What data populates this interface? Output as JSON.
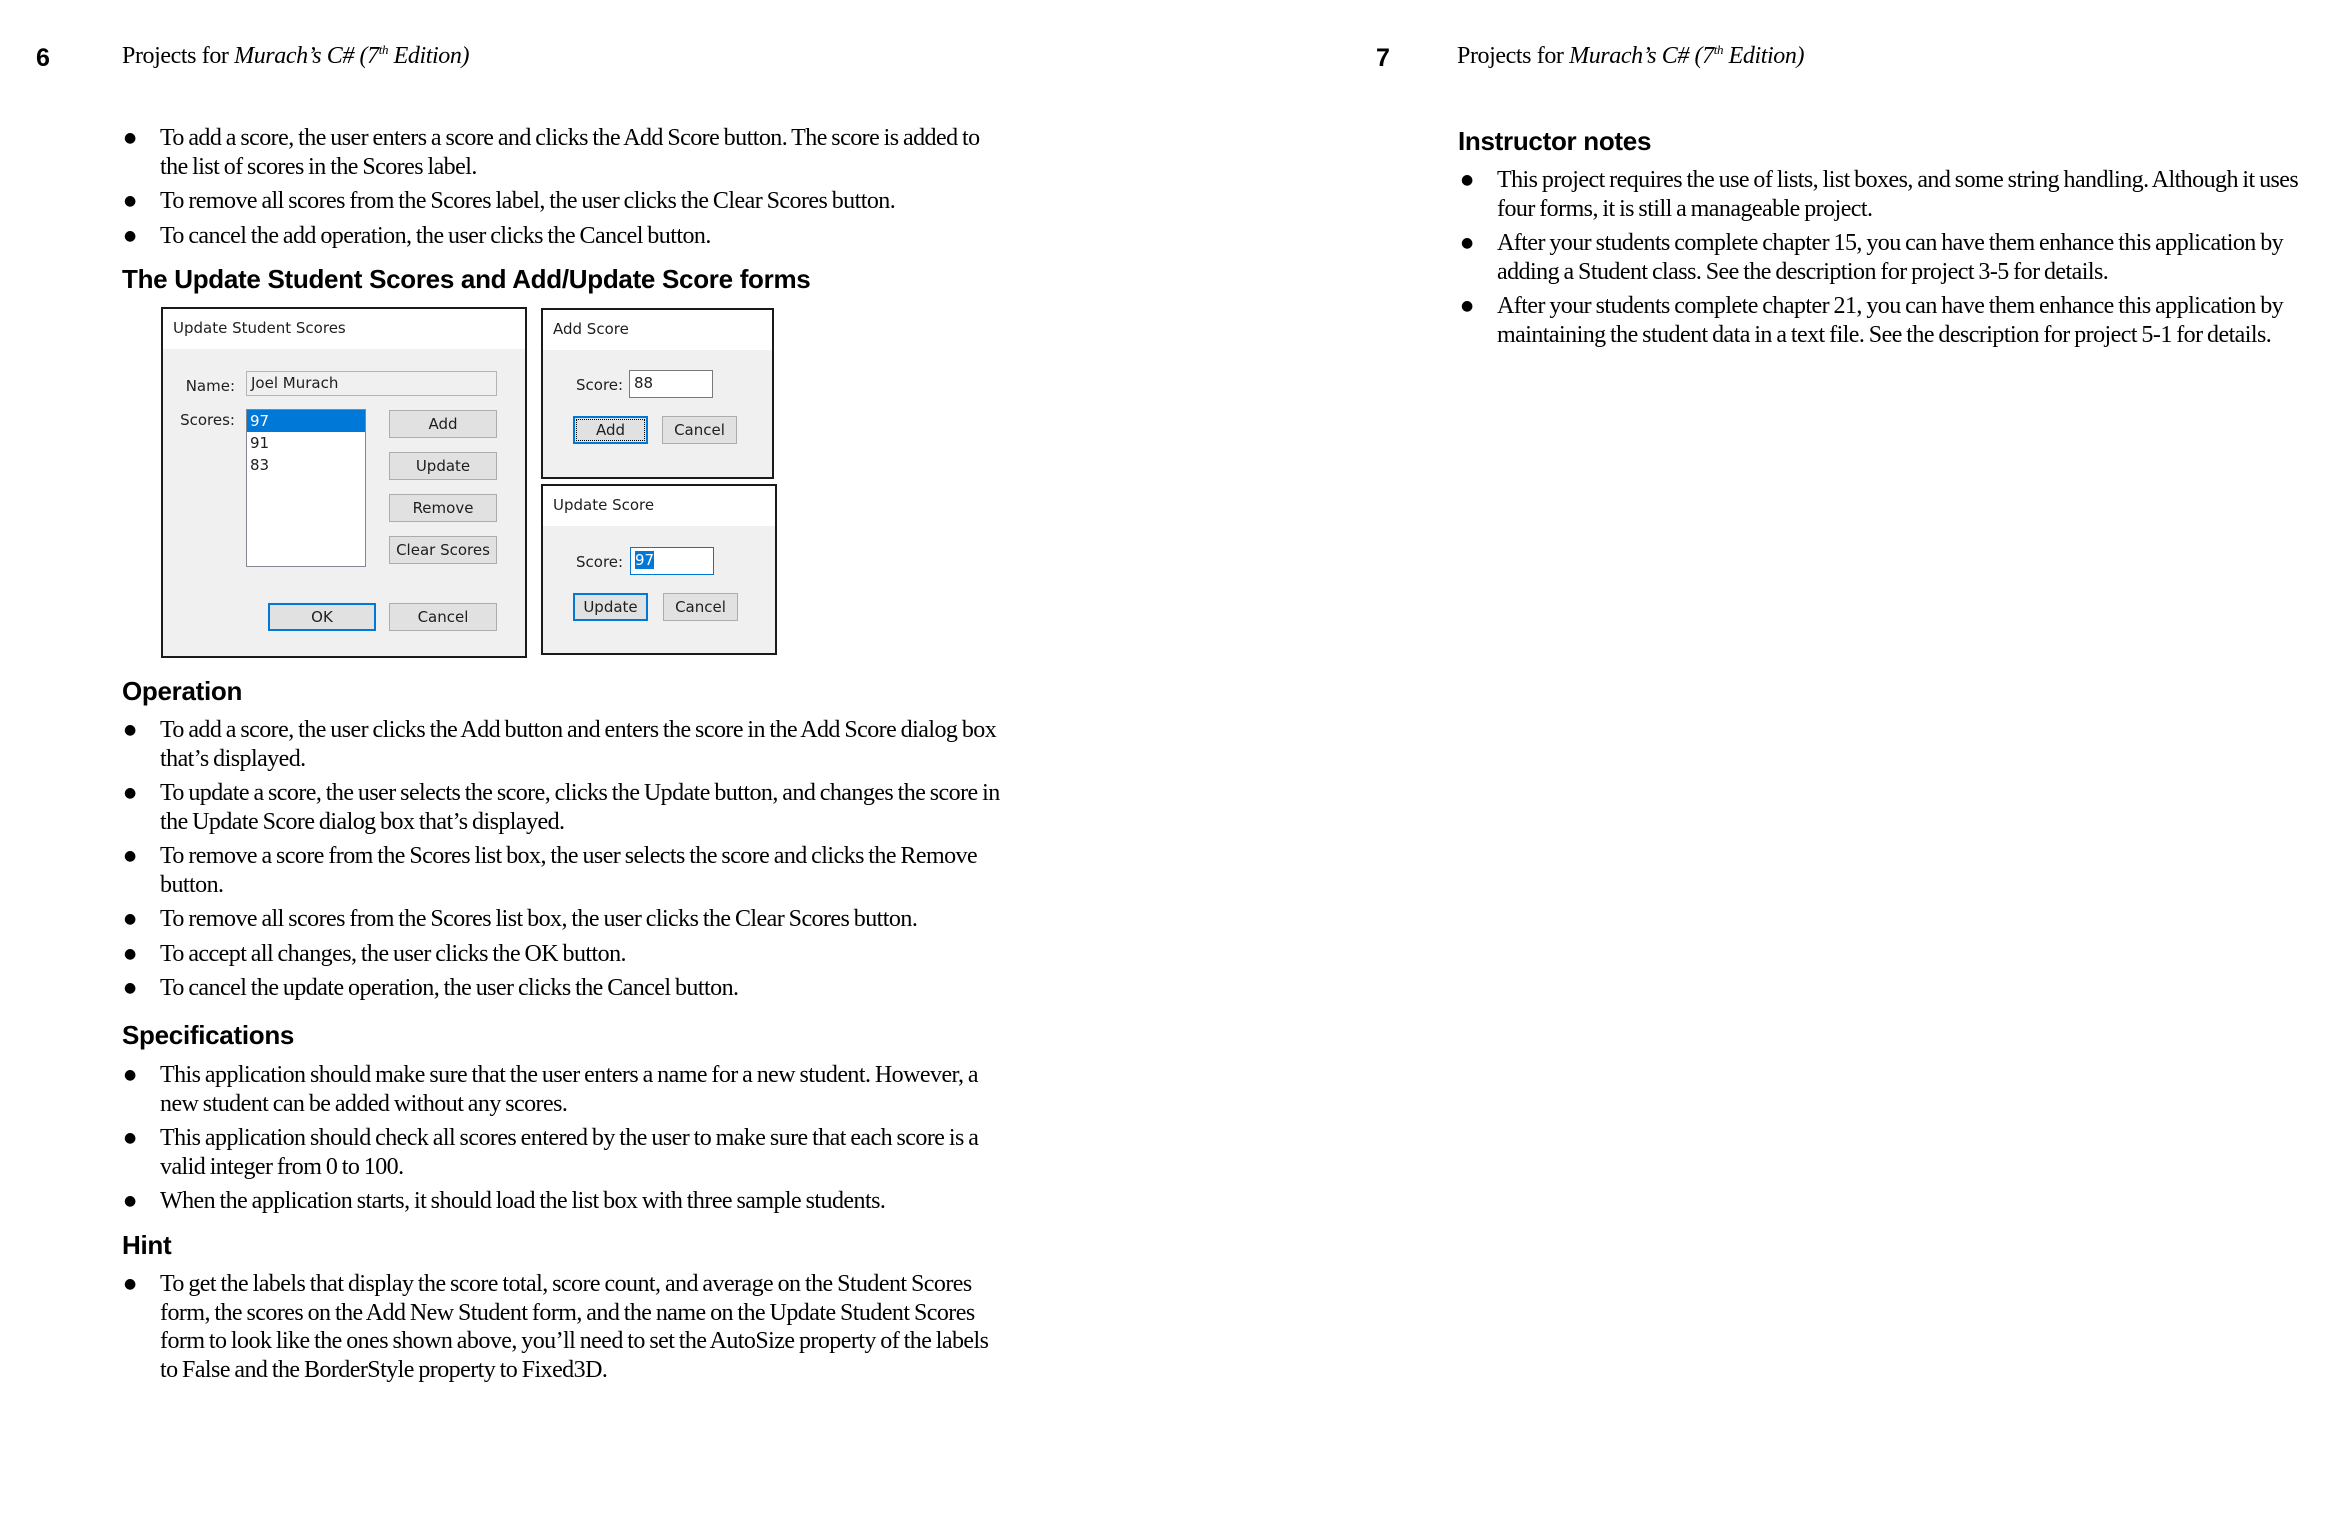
{
  "pages": {
    "left": {
      "page_number": "6",
      "running_head": {
        "prefix": "Projects for ",
        "book": "Murach’s C# (7",
        "sup": "th",
        "suffix": " Edition)"
      },
      "intro_bullets": [
        "To add a score, the user enters a score and clicks the Add Score button. The score is added to the list of scores in the Scores label.",
        "To remove all scores from the Scores label, the user clicks the Clear Scores button.",
        "To cancel the add operation, the user clicks the Cancel button."
      ],
      "forms_heading": "The Update Student Scores and Add/Update Score forms",
      "operation": {
        "heading": "Operation",
        "bullets": [
          "To add a score, the user clicks the Add button and enters the score in the Add Score dialog box that’s displayed.",
          "To update a score, the user selects the score, clicks the Update button, and changes the score in the Update Score dialog box that’s displayed.",
          "To remove a score from the Scores list box, the user selects the score and clicks the Remove button.",
          "To remove all scores from the Scores list box, the user clicks the Clear Scores button.",
          "To accept all changes, the user clicks the OK button.",
          "To cancel the update operation, the user clicks the Cancel button."
        ]
      },
      "specifications": {
        "heading": "Specifications",
        "bullets": [
          "This application should make sure that the user enters a name for a new student. However, a new student can be added without any scores.",
          "This application should check all scores entered by the user to make sure that each score is a valid integer from 0 to 100.",
          "When the application starts, it should load the list box with three sample students."
        ]
      },
      "hint": {
        "heading": "Hint",
        "bullets": [
          "To get the labels that display the score total, score count, and average on the Student Scores form, the scores on the Add New Student form, and the name on the Update Student Scores form to look like the ones shown above, you’ll need to set the AutoSize property of the labels to False and the BorderStyle property to Fixed3D."
        ]
      }
    },
    "right": {
      "page_number": "7",
      "running_head": {
        "prefix": "Projects for ",
        "book": "Murach’s C# (7",
        "sup": "th",
        "suffix": " Edition)"
      },
      "instructor_notes": {
        "heading": "Instructor notes",
        "bullets": [
          "This project requires the use of lists, list boxes, and some string handling. Although it uses four forms, it is still a manageable project.",
          "After your students complete chapter 15, you can have them enhance this application by adding a Student class. See the description for project 3-5 for details.",
          "After your students complete chapter 21, you can have them enhance this application by maintaining the student data in a text file. See the description for project 5-1 for details."
        ]
      }
    }
  },
  "forms": {
    "update_student_scores": {
      "title": "Update Student Scores",
      "name_label": "Name:",
      "name_value": "Joel Murach",
      "scores_label": "Scores:",
      "scores": [
        "97",
        "91",
        "83"
      ],
      "selected_score": "97",
      "buttons": {
        "add": "Add",
        "update": "Update",
        "remove": "Remove",
        "clear": "Clear Scores",
        "ok": "OK",
        "cancel": "Cancel"
      }
    },
    "add_score": {
      "title": "Add Score",
      "score_label": "Score:",
      "score_value": "88",
      "buttons": {
        "add": "Add",
        "cancel": "Cancel"
      }
    },
    "update_score": {
      "title": "Update Score",
      "score_label": "Score:",
      "score_value": "97",
      "buttons": {
        "update": "Update",
        "cancel": "Cancel"
      }
    }
  },
  "colors": {
    "selection": "#0078d7",
    "form_body": "#f0f0f0",
    "button_face": "#e1e1e1"
  }
}
